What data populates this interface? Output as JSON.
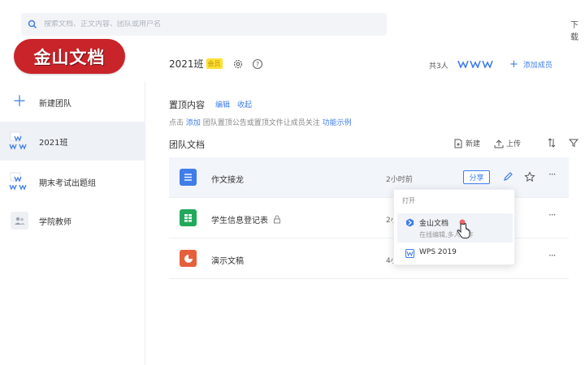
{
  "search": {
    "placeholder": "搜索文档、正文内容、团队或用户名"
  },
  "topbar": {
    "right_text": "下载"
  },
  "brand": {
    "text": "金山文档"
  },
  "sidebar": {
    "items": [
      {
        "label": "新建团队",
        "icon": "plus-icon"
      },
      {
        "label": "2021班",
        "icon": "team-icon",
        "active": true
      },
      {
        "label": "期末考试出题组",
        "icon": "team-icon"
      },
      {
        "label": "学院教师",
        "icon": "users-icon"
      }
    ]
  },
  "header": {
    "title": "2021班",
    "badge": "会员",
    "member_count": "共3人",
    "add_member": "添加成员"
  },
  "pinned": {
    "title": "置顶内容",
    "edit": "编辑",
    "collapse": "收起",
    "desc_prefix": "点击",
    "desc_link": "添加",
    "desc_middle": "团队置顶公告或置顶文件让成员关注",
    "desc_example": "功能示例"
  },
  "docs": {
    "title": "团队文档",
    "new_label": "新建",
    "upload_label": "上传",
    "files": [
      {
        "name": "作文接龙",
        "time": "2小时前",
        "type": "doc",
        "color": "#3f7de9"
      },
      {
        "name": "学生信息登记表",
        "time": "2小时前",
        "type": "sheet",
        "color": "#22a95b",
        "locked": true
      },
      {
        "name": "演示文稿",
        "time": "4小时前",
        "type": "slide",
        "color": "#e5603a"
      }
    ],
    "share_label": "分享"
  },
  "popup": {
    "header": "打开",
    "option1_label": "金山文档",
    "option1_sub": "在线编辑,多人协作",
    "option2_label": "WPS 2019"
  }
}
